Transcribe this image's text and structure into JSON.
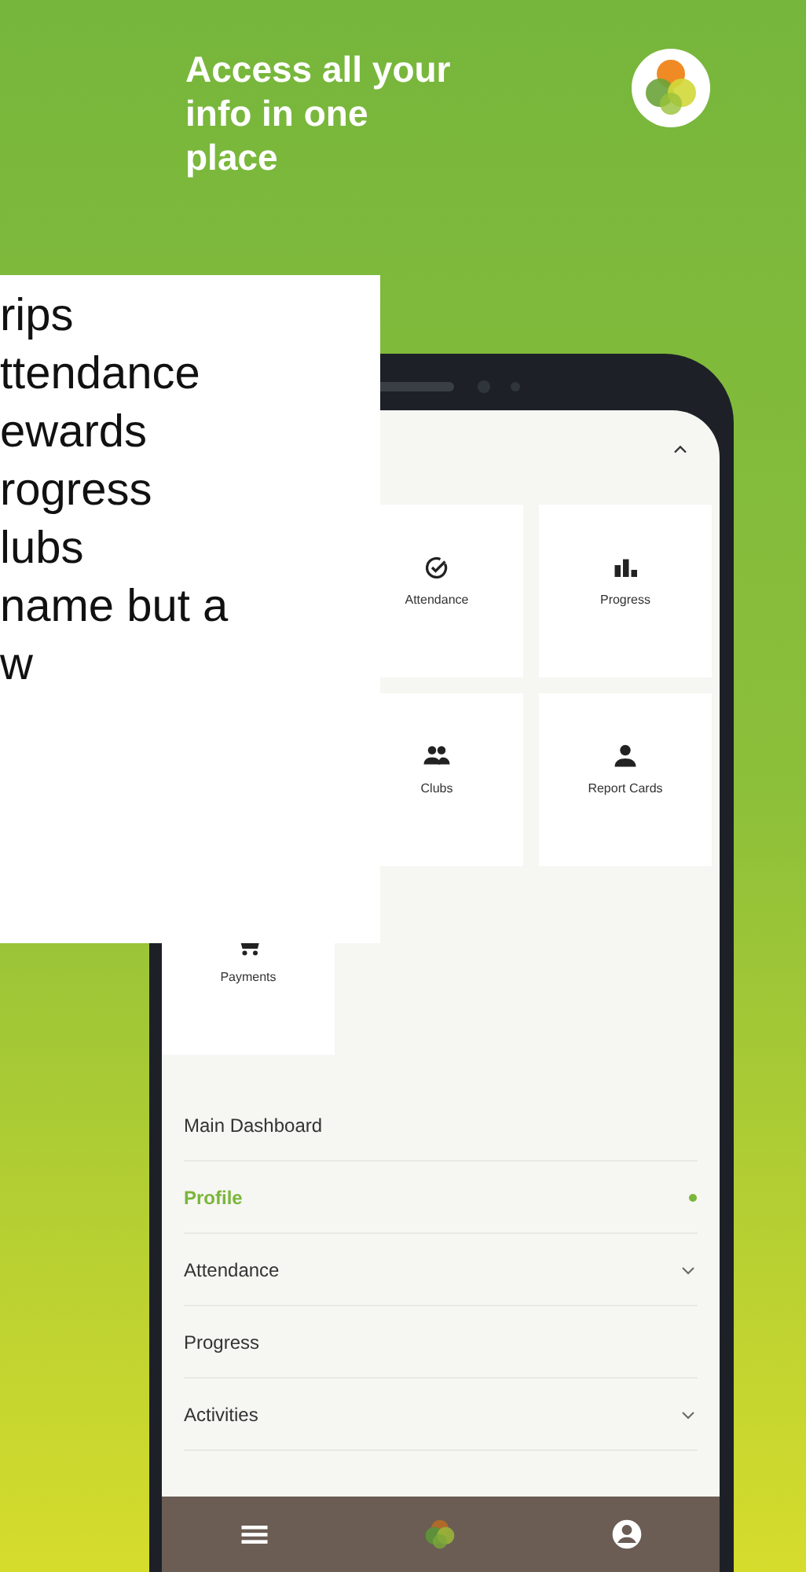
{
  "headline": "Access all your info in one place",
  "overlay_lines": [
    "rips",
    "ttendance",
    "ewards",
    "rogress",
    "lubs",
    "name but a",
    "w"
  ],
  "screen": {
    "collapse_expanded": true,
    "tiles": [
      {
        "label": "Attendance",
        "kind": "check"
      },
      {
        "label": "Progress",
        "kind": "bars"
      },
      {
        "label": "Clubs",
        "kind": "group"
      },
      {
        "label": "Report Cards",
        "kind": "person"
      },
      {
        "label": "Payments",
        "kind": "cart"
      }
    ],
    "menu": [
      {
        "label": "Main Dashboard",
        "selected": false,
        "kind": "link"
      },
      {
        "label": "Profile",
        "selected": true,
        "kind": "link"
      },
      {
        "label": "Attendance",
        "selected": false,
        "kind": "submenu",
        "expanded": false
      },
      {
        "label": "Progress",
        "selected": false,
        "kind": "link"
      },
      {
        "label": "Activities",
        "selected": false,
        "kind": "submenu",
        "expanded": false
      }
    ],
    "bottom_nav": [
      {
        "kind": "menu"
      },
      {
        "kind": "logo"
      },
      {
        "kind": "account"
      }
    ]
  }
}
